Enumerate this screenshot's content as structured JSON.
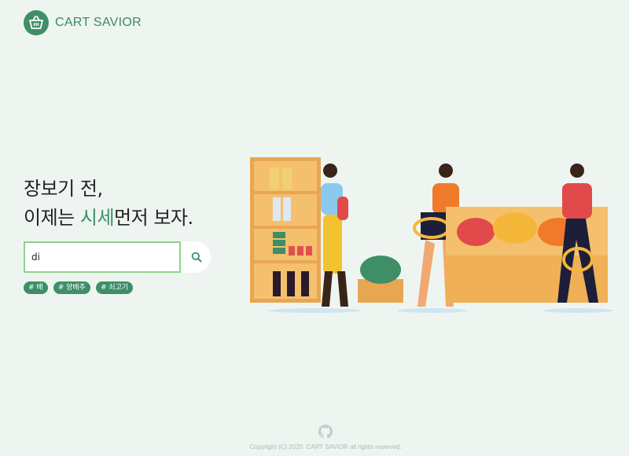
{
  "header": {
    "brand": "CART SAVIOR",
    "logo_icon": "shopping-basket-icon"
  },
  "hero": {
    "line1": "장보기 전,",
    "line2_prefix": "이제는 ",
    "line2_highlight": "시세",
    "line2_suffix": "먼저 보자."
  },
  "search": {
    "value": "di",
    "button_icon": "search-icon"
  },
  "tags": [
    "# 배",
    "# 양배추",
    "# 쇠고기"
  ],
  "footer": {
    "github_icon": "github-icon",
    "copyright": "Copyright (C) 2020. CART SAVIOR all rights reserved."
  },
  "colors": {
    "accent": "#3e8e66",
    "background": "#eef5f1",
    "input_border": "#8fd18a"
  }
}
